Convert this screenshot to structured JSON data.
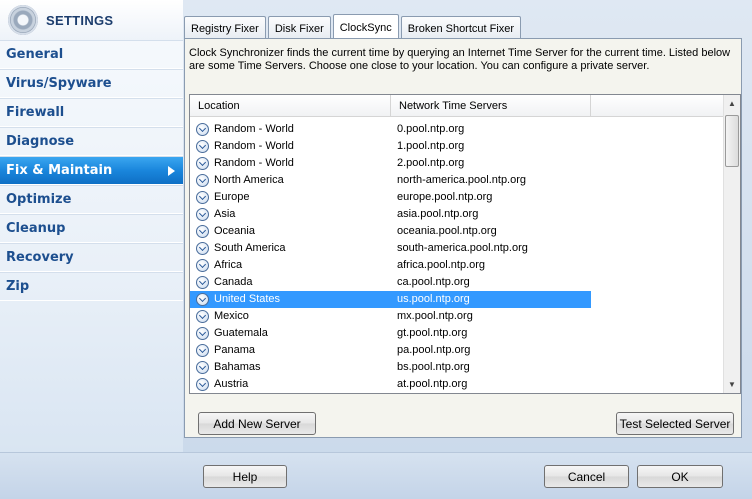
{
  "sidebar": {
    "title": "SETTINGS",
    "items": [
      {
        "label": "General"
      },
      {
        "label": "Virus/Spyware"
      },
      {
        "label": "Firewall"
      },
      {
        "label": "Diagnose"
      },
      {
        "label": "Fix & Maintain"
      },
      {
        "label": "Optimize"
      },
      {
        "label": "Cleanup"
      },
      {
        "label": "Recovery"
      },
      {
        "label": "Zip"
      }
    ],
    "active_index": 4
  },
  "tabs": [
    {
      "label": "Registry Fixer"
    },
    {
      "label": "Disk Fixer"
    },
    {
      "label": "ClockSync"
    },
    {
      "label": "Broken Shortcut Fixer"
    }
  ],
  "active_tab": 2,
  "description": "Clock Synchronizer finds the current time by querying an Internet Time Server for the current time.  Listed below are some Time Servers.  Choose one close to your location.  You can configure a private server.",
  "list": {
    "columns": [
      "Location",
      "Network Time Servers"
    ],
    "rows": [
      {
        "location": "Random - World",
        "server": "0.pool.ntp.org"
      },
      {
        "location": "Random - World",
        "server": "1.pool.ntp.org"
      },
      {
        "location": "Random - World",
        "server": "2.pool.ntp.org"
      },
      {
        "location": "North America",
        "server": "north-america.pool.ntp.org"
      },
      {
        "location": "Europe",
        "server": "europe.pool.ntp.org"
      },
      {
        "location": "Asia",
        "server": "asia.pool.ntp.org"
      },
      {
        "location": "Oceania",
        "server": "oceania.pool.ntp.org"
      },
      {
        "location": "South America",
        "server": "south-america.pool.ntp.org"
      },
      {
        "location": "Africa",
        "server": "africa.pool.ntp.org"
      },
      {
        "location": "Canada",
        "server": "ca.pool.ntp.org"
      },
      {
        "location": "United States",
        "server": "us.pool.ntp.org"
      },
      {
        "location": "Mexico",
        "server": "mx.pool.ntp.org"
      },
      {
        "location": "Guatemala",
        "server": "gt.pool.ntp.org"
      },
      {
        "location": "Panama",
        "server": "pa.pool.ntp.org"
      },
      {
        "location": "Bahamas",
        "server": "bs.pool.ntp.org"
      },
      {
        "location": "Austria",
        "server": "at.pool.ntp.org"
      }
    ],
    "selected_index": 10,
    "row_icon": "chevron-down-circle-icon"
  },
  "buttons": {
    "add_server": "Add New Server",
    "test_server": "Test Selected Server",
    "help": "Help",
    "cancel": "Cancel",
    "ok": "OK"
  },
  "colors": {
    "accent": "#1a86dc",
    "selection": "#3399ff"
  }
}
